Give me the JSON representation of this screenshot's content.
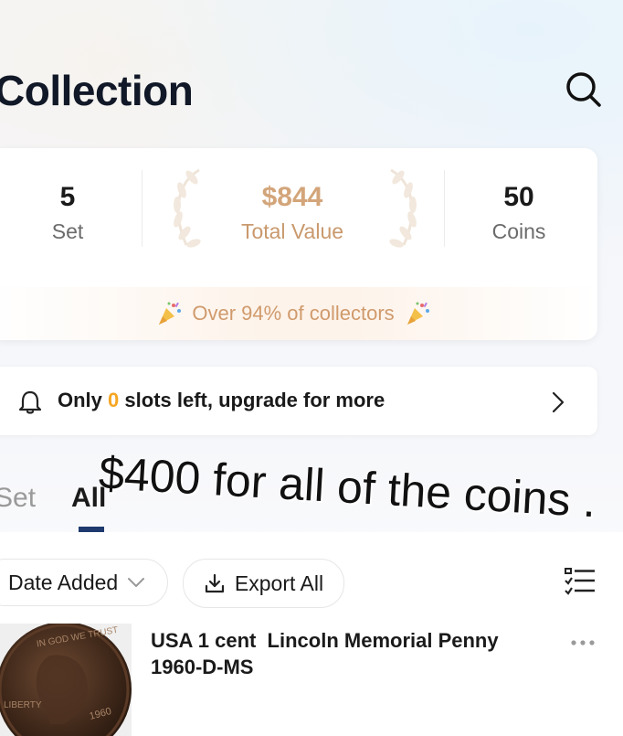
{
  "page": {
    "title": "Collection",
    "search_icon": "search-icon"
  },
  "stats": {
    "sets_value": "5",
    "sets_label": "Set",
    "total_value": "$844",
    "total_label": "Total Value",
    "coins_value": "50",
    "coins_label": "Coins",
    "ranking_text": "Over 94% of collectors",
    "accent_color": "#d3a57a"
  },
  "banner": {
    "text_before": "Only",
    "slots_count": "0",
    "text_after": "slots left, upgrade for more",
    "icon": "bell-icon",
    "accent_color": "#f5a623"
  },
  "tabs": {
    "set_label": "Set",
    "all_label": "All",
    "active": "All"
  },
  "overlay_text": "$400 for all of the coins .",
  "toolbar": {
    "sort_label": "Date Added",
    "export_label": "Export All"
  },
  "coins": [
    {
      "title_line1": "USA 1 cent  Lincoln Memorial Penny",
      "title_line2": "1960-D-MS",
      "thumb_inscriptions": [
        "IN GOD WE TRUST",
        "LIBERTY",
        "1960"
      ]
    }
  ]
}
